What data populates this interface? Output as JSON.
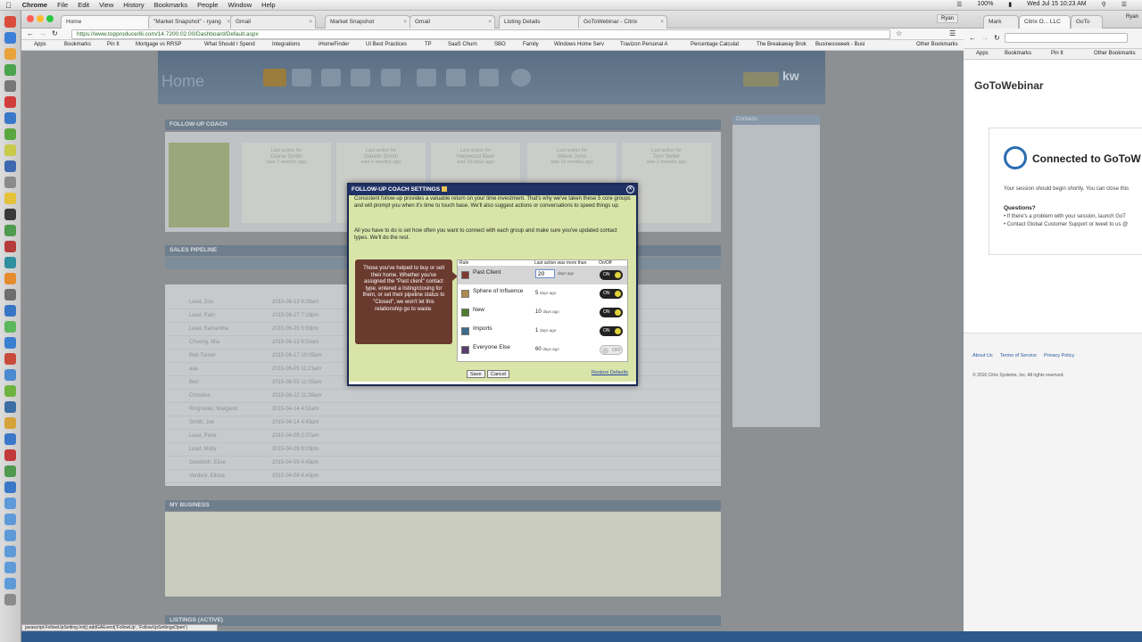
{
  "menubar": {
    "app": "Chrome",
    "items": [
      "File",
      "Edit",
      "View",
      "History",
      "Bookmarks",
      "People",
      "Window",
      "Help"
    ],
    "status": "100%",
    "clock": "Wed Jul 15  10:23 AM",
    "user": "Ryan"
  },
  "tabs": [
    {
      "label": "Home"
    },
    {
      "label": "\"Market Snapshot\" - ryang"
    },
    {
      "label": "Gmail"
    },
    {
      "label": "Market Snapshot"
    },
    {
      "label": "Gmail"
    },
    {
      "label": "Listing Details"
    },
    {
      "label": "GoToWebinar - Citrix"
    }
  ],
  "address": {
    "url": "https://www.topproducer8i.com/14.7200.02.00/Dashboard/Default.aspx"
  },
  "bookmarks": [
    "Apps",
    "Bookmarks",
    "Pin It",
    "Mortgage vs RRSP",
    "What Should I Spend",
    "Integrations",
    "iHomeFinder",
    "UI Best Practices",
    "TP",
    "SaaS Churn",
    "SBO",
    "Family",
    "Windows Home Serv",
    "Travizon Personal A",
    "Percentage Calculat",
    "The Breakaway Brok",
    "Businessweek - Busi",
    "Other Bookmarks"
  ],
  "page": {
    "title": "Home",
    "follow_up_header": "FOLLOW-UP COACH",
    "sales_pipeline_header": "SALES PIPELINE",
    "my_business_header": "MY BUSINESS",
    "listings_header": "LISTINGS (ACTIVE)",
    "contacts_header": "Contacts",
    "coach_cards": [
      {
        "top": "Last action for",
        "name": "Diane Smith",
        "when": "was 2 months ago"
      },
      {
        "top": "Last action for",
        "name": "Gareth Smith",
        "when": "was 4 months ago"
      },
      {
        "top": "Last action for",
        "name": "Heywood Beel",
        "when": "was 23 days ago"
      },
      {
        "top": "Last action for",
        "name": "Steve Jons",
        "when": "was 12 months ago"
      },
      {
        "top": "Last action for",
        "name": "Tom Seller",
        "when": "was 2 months ago"
      }
    ],
    "pipeline_names": [
      "Lead, Zoo",
      "Lead, Pam",
      "Lead, Samantha",
      "Chuong, Mia",
      "Bob Turner",
      "aaa",
      "Ben",
      "Christine",
      "Ringmeier, Margaret",
      "Smith, Joe",
      "Lead, Peter",
      "Lead, Molly",
      "Goodrich, Elise",
      "Verdeni, Elissa"
    ],
    "pipeline_created": [
      "2015-06-13 9:28am",
      "2015-06-27 7:19pm",
      "2015-06-25 5:50pm",
      "2015-06-13 9:53am",
      "2015-06-17 10:09am",
      "2015-06-05 11:21am",
      "2015-06-05 11:05am",
      "2015-06-22 11:39am",
      "2015-04-14 4:51am",
      "2015-04-14 4:49am",
      "2015-04-09 2:07am",
      "2015-04-09 8:03pm",
      "2015-04-09 4:48pm",
      "2015-04-09 4:40pm"
    ]
  },
  "modal": {
    "title": "FOLLOW-UP COACH SETTINGS",
    "intro": "Consistent follow-up provides a valuable return on your time investment. That's why we've taken these 5 core groups and will prompt you when it's time to touch base. We'll also suggest actions or conversations to speed things up.",
    "intro2": "All you have to do is set how often you want to connect with each group and make sure you've updated contact types. We'll do the rest.",
    "tip": "Those you've helped to buy or sell their home. Whether you've assigned the \"Past client\" contact type, entered a listing/closing for them, or set their pipeline status to \"Closed\", we won't let this relationship go to waste.",
    "col_rule": "Rule",
    "col_last": "Last action was more than",
    "col_onoff": "On/Off",
    "rules": [
      {
        "name": "Past Client",
        "days": "20",
        "unit": "days ago",
        "state": "ON",
        "color": "#7a3a32"
      },
      {
        "name": "Sphere of Influence",
        "days": "5",
        "unit": "days ago",
        "state": "ON",
        "color": "#b08a4e"
      },
      {
        "name": "New",
        "days": "10",
        "unit": "days ago",
        "state": "ON",
        "color": "#4f7a2e"
      },
      {
        "name": "Imports",
        "days": "1",
        "unit": "days ago",
        "state": "ON",
        "color": "#3d6a8a"
      },
      {
        "name": "Everyone Else",
        "days": "60",
        "unit": "days ago",
        "state": "OFF",
        "color": "#5a3d6e"
      }
    ],
    "save": "Save",
    "cancel": "Cancel",
    "restore": "Restore Defaults"
  },
  "status_bar": "javascript:FollowUpSetting.Init();addGAEvent('FollowUp', 'FollowUpSettingsOpen')",
  "right_window": {
    "tabs": [
      "Mark",
      "Citrix O... LLC",
      "GoTo"
    ],
    "bookmarks": [
      "Apps",
      "Bookmarks",
      "Pin It",
      "Other Bookmarks"
    ],
    "logo": "GoToWebinar",
    "connected": "Connected to GoToW",
    "session": "Your session should begin shortly. You can close this",
    "questions": "Questions?",
    "q1": "• If there's a problem with your session, launch GoT",
    "q2": "• Contact Global Customer Support or tweet to us @",
    "footer_links": [
      "About Us",
      "Terms of Service",
      "Privacy Policy"
    ],
    "copyright": "© 2016 Citrix Systems, Inc. All rights reserved."
  }
}
